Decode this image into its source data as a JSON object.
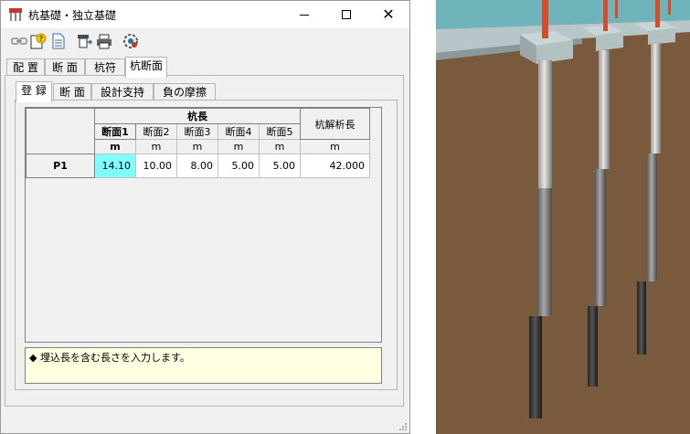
{
  "window": {
    "title": "杭基礎・独立基礎",
    "close_glyph": "✕"
  },
  "toolbar": {
    "icons": [
      "link-icon",
      "help-question-icon",
      "document-icon",
      "export-icon",
      "print-icon",
      "settings-gear-icon"
    ]
  },
  "outer_tabs": [
    {
      "label": "配 置",
      "active": false
    },
    {
      "label": "断 面",
      "active": false
    },
    {
      "label": "杭符号",
      "active": false
    },
    {
      "label": "杭断面",
      "active": true
    }
  ],
  "inner_tabs": [
    {
      "label": "登 録",
      "active": true
    },
    {
      "label": "断 面",
      "active": false
    },
    {
      "label": "設計支持力",
      "active": false
    },
    {
      "label": "負の摩擦力",
      "active": false
    }
  ],
  "grid": {
    "group_header": "杭長",
    "analysis_header": "杭解析長",
    "columns": [
      "断面1",
      "断面2",
      "断面3",
      "断面4",
      "断面5"
    ],
    "units": [
      "m",
      "m",
      "m",
      "m",
      "m",
      "m"
    ],
    "rows": [
      {
        "label": "P1",
        "values": [
          "14.10",
          "10.00",
          "8.00",
          "5.00",
          "5.00"
        ],
        "analysis_length": "42.000"
      }
    ],
    "selected_color": "#80ffff"
  },
  "message": "◆ 埋込長を含む長さを入力します。",
  "colors": {
    "message_bg": "#ffffe1",
    "ground": "#7a5a3c",
    "water": "#5fa8b0",
    "rebar": "#d84a2a"
  }
}
